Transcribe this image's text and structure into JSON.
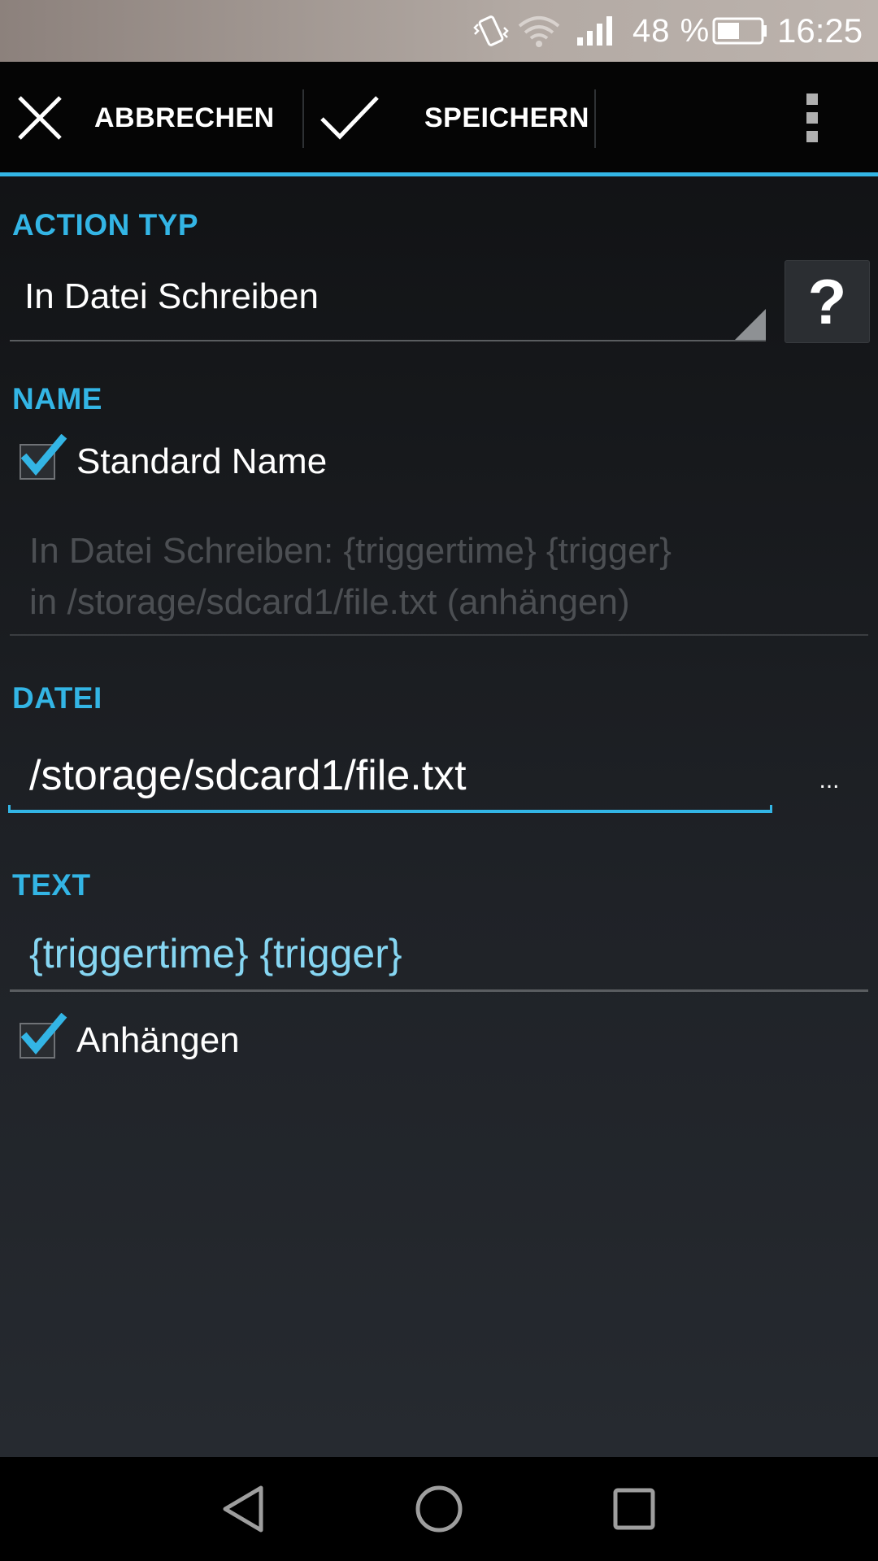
{
  "status_bar": {
    "battery_percent": "48 %",
    "time": "16:25",
    "icons": [
      "vibrate-icon",
      "wifi-icon",
      "signal-icon",
      "battery-icon"
    ]
  },
  "action_bar": {
    "cancel_label": "ABBRECHEN",
    "save_label": "SPEICHERN",
    "icons": [
      "close-icon",
      "checkmark-icon",
      "overflow-menu-icon"
    ]
  },
  "action_type": {
    "header": "ACTION TYP",
    "selected": "In Datei Schreiben",
    "help_label": "?"
  },
  "name": {
    "header": "NAME",
    "default_name_label": "Standard Name",
    "default_name_checked": true,
    "value_line1": "In Datei Schreiben: {triggertime} {trigger}",
    "value_line2": "in /storage/sdcard1/file.txt (anhängen)"
  },
  "file": {
    "header": "DATEI",
    "path": "/storage/sdcard1/file.txt",
    "browse_label": "..."
  },
  "text": {
    "header": "TEXT",
    "value": "{triggertime} {trigger}",
    "append_label": "Anhängen",
    "append_checked": true
  },
  "colors": {
    "accent": "#33b5e5",
    "text_value": "#86d6f2",
    "disabled_text": "#4c4f53"
  },
  "nav_bar": {
    "icons": [
      "back-icon",
      "home-icon",
      "recents-icon"
    ]
  }
}
